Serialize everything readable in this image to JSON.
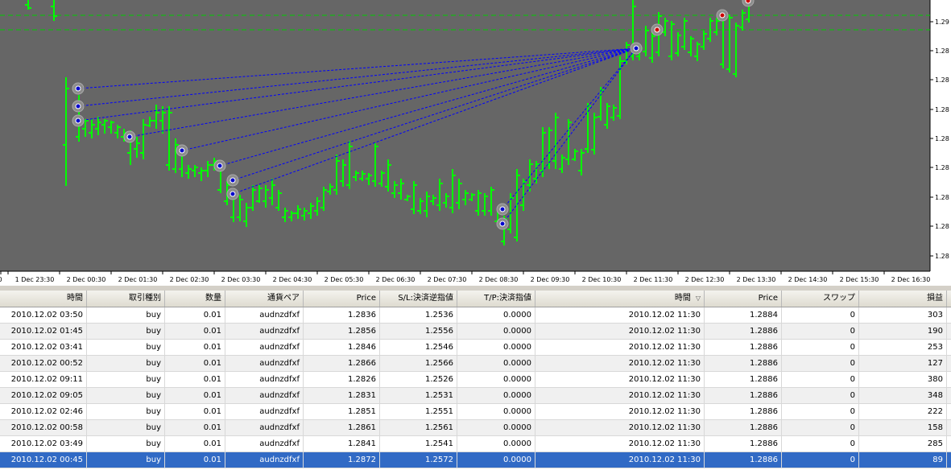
{
  "chart": {
    "background": "#666666",
    "candle_color": "#00ff00",
    "line_color": "#0000ff",
    "level_color": "#00cc00",
    "price_labels": [
      "1.29",
      "1.28",
      "1.28",
      "1.28",
      "1.28",
      "1.28",
      "1.28",
      "1.28",
      "1.28"
    ],
    "time_labels": [
      "0",
      "1 Dec 23:30",
      "2 Dec 00:30",
      "2 Dec 01:30",
      "2 Dec 02:30",
      "2 Dec 03:30",
      "2 Dec 04:30",
      "2 Dec 05:30",
      "2 Dec 06:30",
      "2 Dec 07:30",
      "2 Dec 08:30",
      "2 Dec 09:30",
      "2 Dec 10:30",
      "2 Dec 11:30",
      "2 Dec 12:30",
      "2 Dec 13:30",
      "2 Dec 14:30",
      "2 Dec 15:30",
      "2 Dec 16:30"
    ]
  },
  "columns": [
    "時間",
    "取引種別",
    "数量",
    "通貨ペア",
    "Price",
    "S/L:決済逆指値",
    "T/P:決済指値",
    "時間",
    "Price",
    "スワップ",
    "損益"
  ],
  "sort_indicator": "▽",
  "rows": [
    [
      "2010.12.02 03:50",
      "buy",
      "0.01",
      "audnzdfxf",
      "1.2836",
      "1.2536",
      "0.0000",
      "2010.12.02 11:30",
      "1.2884",
      "0",
      "303"
    ],
    [
      "2010.12.02 01:45",
      "buy",
      "0.01",
      "audnzdfxf",
      "1.2856",
      "1.2556",
      "0.0000",
      "2010.12.02 11:30",
      "1.2886",
      "0",
      "190"
    ],
    [
      "2010.12.02 03:41",
      "buy",
      "0.01",
      "audnzdfxf",
      "1.2846",
      "1.2546",
      "0.0000",
      "2010.12.02 11:30",
      "1.2886",
      "0",
      "253"
    ],
    [
      "2010.12.02 00:52",
      "buy",
      "0.01",
      "audnzdfxf",
      "1.2866",
      "1.2566",
      "0.0000",
      "2010.12.02 11:30",
      "1.2886",
      "0",
      "127"
    ],
    [
      "2010.12.02 09:11",
      "buy",
      "0.01",
      "audnzdfxf",
      "1.2826",
      "1.2526",
      "0.0000",
      "2010.12.02 11:30",
      "1.2886",
      "0",
      "380"
    ],
    [
      "2010.12.02 09:05",
      "buy",
      "0.01",
      "audnzdfxf",
      "1.2831",
      "1.2531",
      "0.0000",
      "2010.12.02 11:30",
      "1.2886",
      "0",
      "348"
    ],
    [
      "2010.12.02 02:46",
      "buy",
      "0.01",
      "audnzdfxf",
      "1.2851",
      "1.2551",
      "0.0000",
      "2010.12.02 11:30",
      "1.2886",
      "0",
      "222"
    ],
    [
      "2010.12.02 00:58",
      "buy",
      "0.01",
      "audnzdfxf",
      "1.2861",
      "1.2561",
      "0.0000",
      "2010.12.02 11:30",
      "1.2886",
      "0",
      "158"
    ],
    [
      "2010.12.02 03:49",
      "buy",
      "0.01",
      "audnzdfxf",
      "1.2841",
      "1.2541",
      "0.0000",
      "2010.12.02 11:30",
      "1.2886",
      "0",
      "285"
    ],
    [
      "2010.12.02 00:45",
      "buy",
      "0.01",
      "audnzdfxf",
      "1.2872",
      "1.2572",
      "0.0000",
      "2010.12.02 11:30",
      "1.2886",
      "0",
      "89"
    ]
  ],
  "selected_row": 9
}
